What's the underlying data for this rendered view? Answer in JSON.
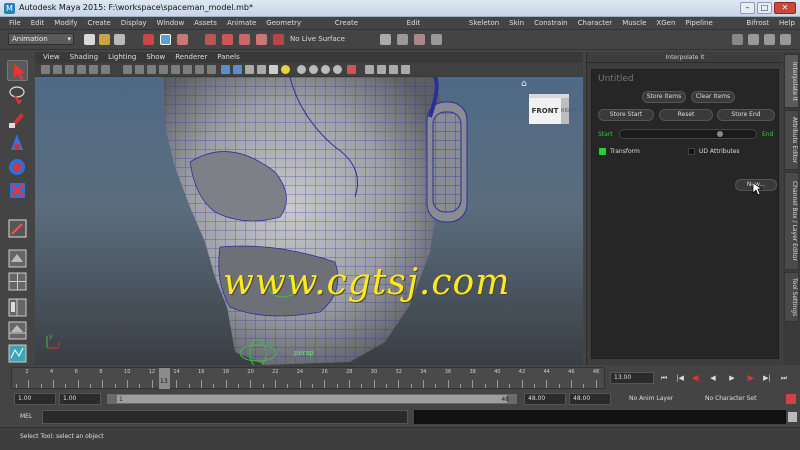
{
  "window": {
    "title": "Autodesk Maya 2015: F:\\workspace\\spaceman_model.mb*",
    "minimize": "–",
    "maximize": "□",
    "close": "✕"
  },
  "menubar": [
    "File",
    "Edit",
    "Modify",
    "Create",
    "Display",
    "Window",
    "Assets",
    "Animate",
    "Geometry Cache",
    "Create Deformers",
    "Edit Deformers",
    "Skeleton",
    "Skin",
    "Constrain",
    "Character",
    "Muscle",
    "XGen",
    "Pipeline Cache",
    "Bifrost",
    "Help"
  ],
  "statusline": {
    "mode": "Animation",
    "live_surface": "No Live Surface"
  },
  "viewport": {
    "menu": [
      "View",
      "Shading",
      "Lighting",
      "Show",
      "Renderer",
      "Panels"
    ],
    "viewcube_front": "FRONT",
    "viewcube_side": "RIGHT",
    "camera_label": "persp",
    "axis_y": "y",
    "axis_x": "x",
    "watermark": "www.cgtsj.com"
  },
  "interpolate_panel": {
    "title": "Interpolate It",
    "header": "Untitled",
    "store_items": "Store Items",
    "clear_items": "Clear Items",
    "store_start": "Store Start",
    "reset": "Reset",
    "store_end": "Store End",
    "start_label": "Start",
    "end_label": "End",
    "slider_value": 0.74,
    "transform_label": "Transform",
    "transform_checked": true,
    "ud_attributes_label": "UD Attributes",
    "ud_attributes_checked": false,
    "new_button": "New..."
  },
  "side_tabs": [
    "Interpolate It",
    "Attribute Editor",
    "Channel Box / Layer Editor",
    "Tool Settings"
  ],
  "timeline": {
    "ticks": [
      2,
      4,
      6,
      8,
      10,
      12,
      14,
      16,
      18,
      20,
      22,
      24,
      26,
      28,
      30,
      32,
      34,
      36,
      38,
      40,
      42,
      44,
      46,
      48
    ],
    "current_frame": "13",
    "current_time": "13.00"
  },
  "range": {
    "start_time": "1.00",
    "playback_start": "1.00",
    "range_start": "1",
    "range_end": "48",
    "playback_end": "48.00",
    "end_time": "48.00",
    "anim_layer": "No Anim Layer",
    "character_set": "No Character Set"
  },
  "command_line": {
    "label": "MEL"
  },
  "help_line": {
    "text": "Select Tool: select an object"
  },
  "colors": {
    "accent_green": "#2fcc3a",
    "watermark": "#ffe91c",
    "camera_label": "#6de36d"
  }
}
